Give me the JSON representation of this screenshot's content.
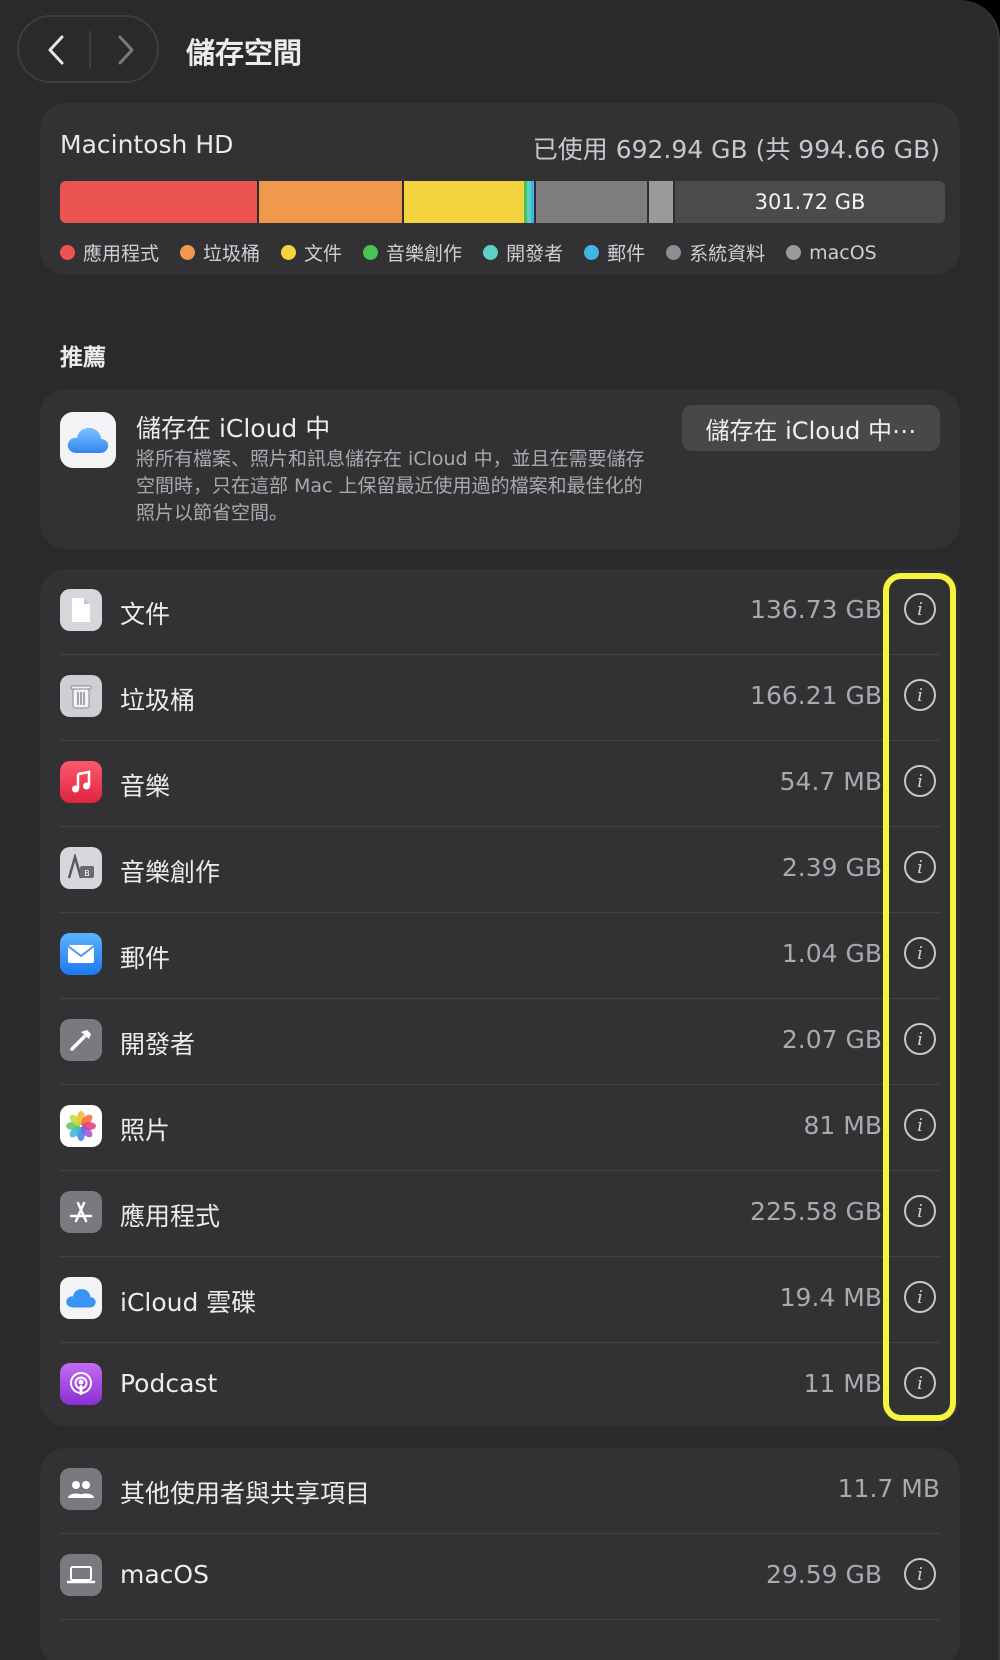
{
  "header": {
    "title": "儲存空間",
    "back_icon": "chevron-left-icon",
    "forward_icon": "chevron-right-icon"
  },
  "disk": {
    "name": "Macintosh HD",
    "usage": "已使用 692.94 GB (共 994.66 GB)",
    "available": "301.72 GB",
    "legend": [
      {
        "label": "應用程式",
        "color": "#ec5452"
      },
      {
        "label": "垃圾桶",
        "color": "#f0984b"
      },
      {
        "label": "文件",
        "color": "#f3d43f"
      },
      {
        "label": "音樂創作",
        "color": "#4cc15a"
      },
      {
        "label": "開發者",
        "color": "#5ad0c6"
      },
      {
        "label": "郵件",
        "color": "#3fb6e6"
      },
      {
        "label": "系統資料",
        "color": "#8e8e93"
      },
      {
        "label": "macOS",
        "color": "#9a9a9d"
      }
    ]
  },
  "recommendations": {
    "section_title": "推薦",
    "icloud": {
      "title": "儲存在 iCloud 中",
      "description": "將所有檔案、照片和訊息儲存在 iCloud 中，並且在需要儲存空間時，只在這部 Mac 上保留最近使用過的檔案和最佳化的照片以節省空間。",
      "button_label": "儲存在 iCloud 中⋯"
    }
  },
  "categories": [
    {
      "label": "文件",
      "size": "136.73 GB",
      "icon": "document-icon"
    },
    {
      "label": "垃圾桶",
      "size": "166.21 GB",
      "icon": "trash-icon"
    },
    {
      "label": "音樂",
      "size": "54.7 MB",
      "icon": "music-note-icon"
    },
    {
      "label": "音樂創作",
      "size": "2.39 GB",
      "icon": "music-creation-icon"
    },
    {
      "label": "郵件",
      "size": "1.04 GB",
      "icon": "mail-icon"
    },
    {
      "label": "開發者",
      "size": "2.07 GB",
      "icon": "hammer-icon"
    },
    {
      "label": "照片",
      "size": "81 MB",
      "icon": "photos-icon"
    },
    {
      "label": "應用程式",
      "size": "225.58 GB",
      "icon": "app-store-icon"
    },
    {
      "label": "iCloud 雲碟",
      "size": "19.4 MB",
      "icon": "icloud-drive-icon"
    },
    {
      "label": "Podcast",
      "size": "11 MB",
      "icon": "podcast-icon"
    }
  ],
  "other": [
    {
      "label": "其他使用者與共享項目",
      "size": "11.7 MB",
      "icon": "users-icon"
    },
    {
      "label": "macOS",
      "size": "29.59 GB",
      "icon": "laptop-icon"
    }
  ],
  "info_icon": "info-icon"
}
